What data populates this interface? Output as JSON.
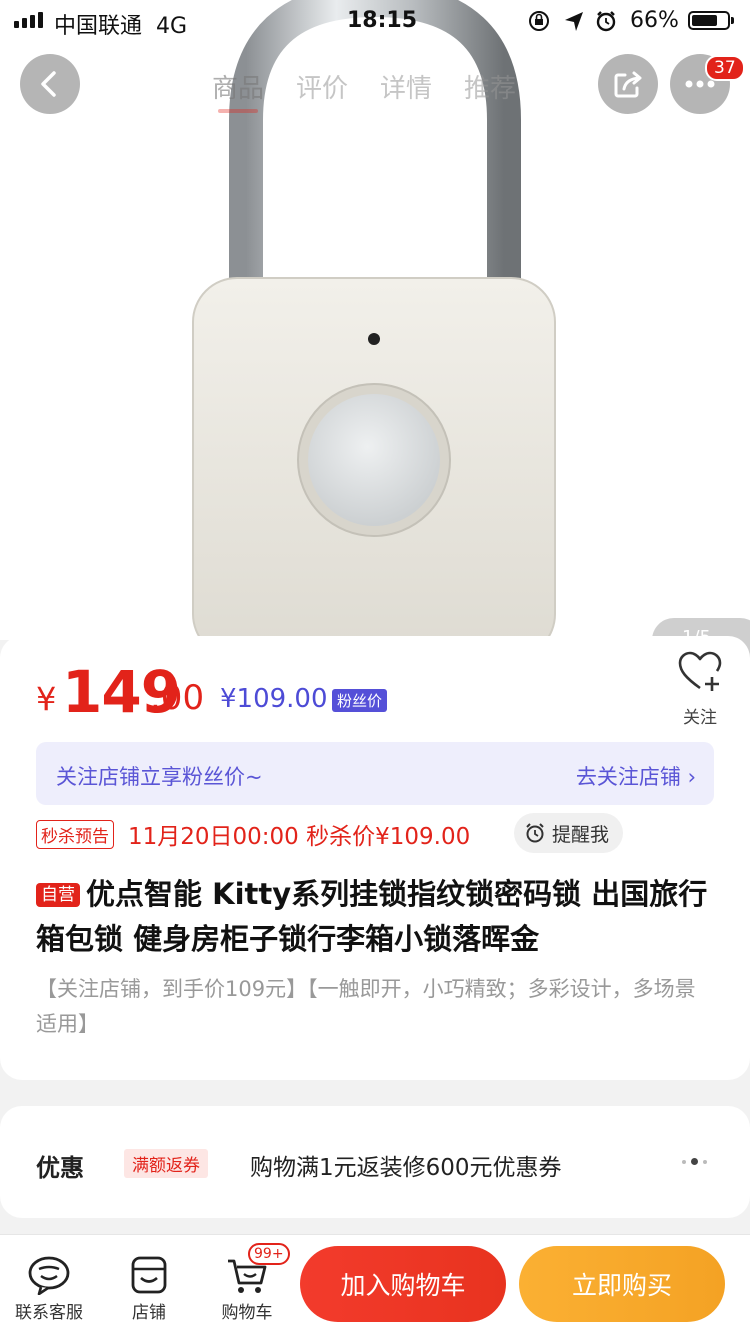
{
  "status_bar": {
    "carrier": "中国联通",
    "network": "4G",
    "time": "18:15",
    "battery": "66%",
    "icons": [
      "signal-icon",
      "orientation-lock-icon",
      "location-arrow-icon",
      "alarm-icon",
      "battery-icon"
    ]
  },
  "header": {
    "tabs": [
      {
        "label": "商品",
        "active": true
      },
      {
        "label": "评价",
        "active": false
      },
      {
        "label": "详情",
        "active": false
      },
      {
        "label": "推荐",
        "active": false
      }
    ],
    "message_badge": "37",
    "icons": [
      "back-icon",
      "share-icon",
      "more-icon"
    ]
  },
  "gallery": {
    "pager": "1/5",
    "image": "白色指纹挂锁"
  },
  "price": {
    "symbol": "¥",
    "integer": "149",
    "decimal": ".00",
    "fan_price": "¥109.00",
    "fan_tag": "粉丝价"
  },
  "follow": {
    "label": "关注"
  },
  "banner": {
    "left": "关注店铺立享粉丝价~",
    "right": "去关注店铺"
  },
  "seckill": {
    "tag": "秒杀预告",
    "text": "11月20日00:00 秒杀价¥109.00",
    "remind_label": "提醒我"
  },
  "product": {
    "self_tag": "自营",
    "title": "优点智能 Kitty系列挂锁指纹锁密码锁 出国旅行箱包锁 健身房柜子锁行李箱小锁落晖金",
    "desc": "【关注店铺，到手价109元】【一触即开，小巧精致；多彩设计，多场景适用】"
  },
  "discount": {
    "label": "优惠",
    "tag": "满额返券",
    "text": "购物满1元返装修600元优惠券"
  },
  "bottom_bar": {
    "service_label": "联系客服",
    "shop_label": "店铺",
    "cart_label": "购物车",
    "cart_badge": "99+",
    "add_cart_label": "加入购物车",
    "buy_now_label": "立即购买"
  },
  "colors": {
    "brand_red": "#e2231a",
    "fan_purple": "#5550d8",
    "buy_orange": "#f6a62a"
  }
}
